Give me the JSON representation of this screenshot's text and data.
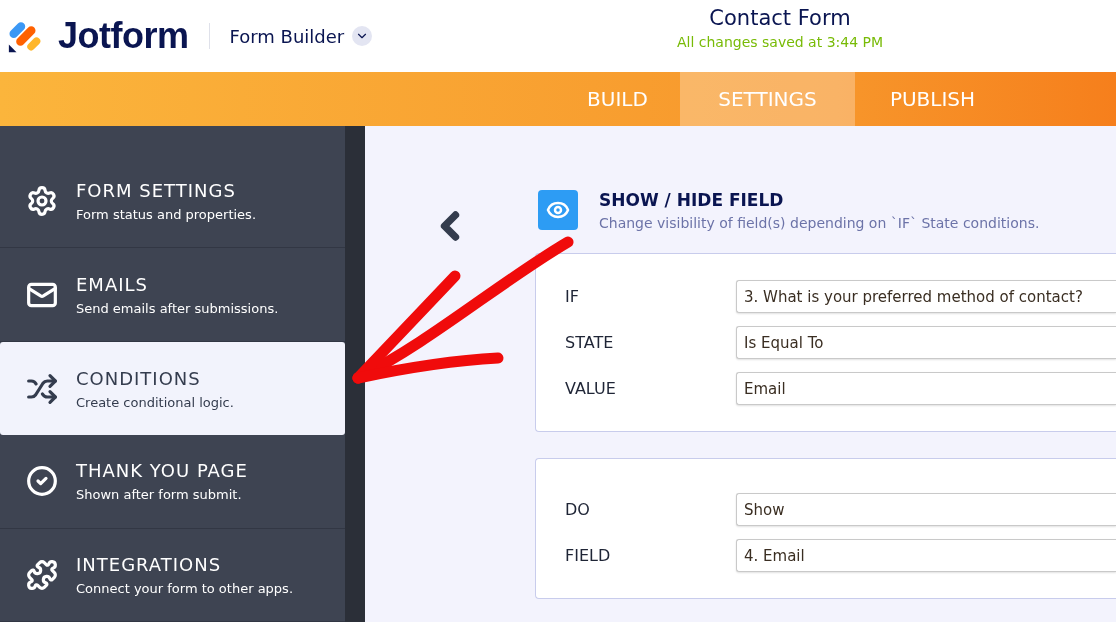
{
  "header": {
    "logo": "Jotform",
    "product": "Form Builder",
    "form_title": "Contact Form",
    "save_status": "All changes saved at 3:44 PM"
  },
  "tabs": [
    {
      "label": "BUILD",
      "selected": false
    },
    {
      "label": "SETTINGS",
      "selected": true
    },
    {
      "label": "PUBLISH",
      "selected": false
    }
  ],
  "sidebar": {
    "items": [
      {
        "kind": "gear",
        "title": "FORM SETTINGS",
        "subtitle": "Form status and properties.",
        "selected": false
      },
      {
        "kind": "mail",
        "title": "EMAILS",
        "subtitle": "Send emails after submissions.",
        "selected": false
      },
      {
        "kind": "shuffle",
        "title": "CONDITIONS",
        "subtitle": "Create conditional logic.",
        "selected": true
      },
      {
        "kind": "check",
        "title": "THANK YOU PAGE",
        "subtitle": "Shown after form submit.",
        "selected": false
      },
      {
        "kind": "puzzle",
        "title": "INTEGRATIONS",
        "subtitle": "Connect your form to other apps.",
        "selected": false
      }
    ]
  },
  "condition": {
    "title": "SHOW / HIDE FIELD",
    "description": "Change visibility of field(s) depending on `IF` State conditions.",
    "groups": [
      {
        "rows": [
          {
            "label": "IF",
            "value": "3. What is your preferred method of contact?"
          },
          {
            "label": "STATE",
            "value": "Is Equal To"
          },
          {
            "label": "VALUE",
            "value": "Email"
          }
        ]
      },
      {
        "rows": [
          {
            "label": "DO",
            "value": "Show"
          },
          {
            "label": "FIELD",
            "value": "4. Email"
          }
        ]
      }
    ]
  }
}
